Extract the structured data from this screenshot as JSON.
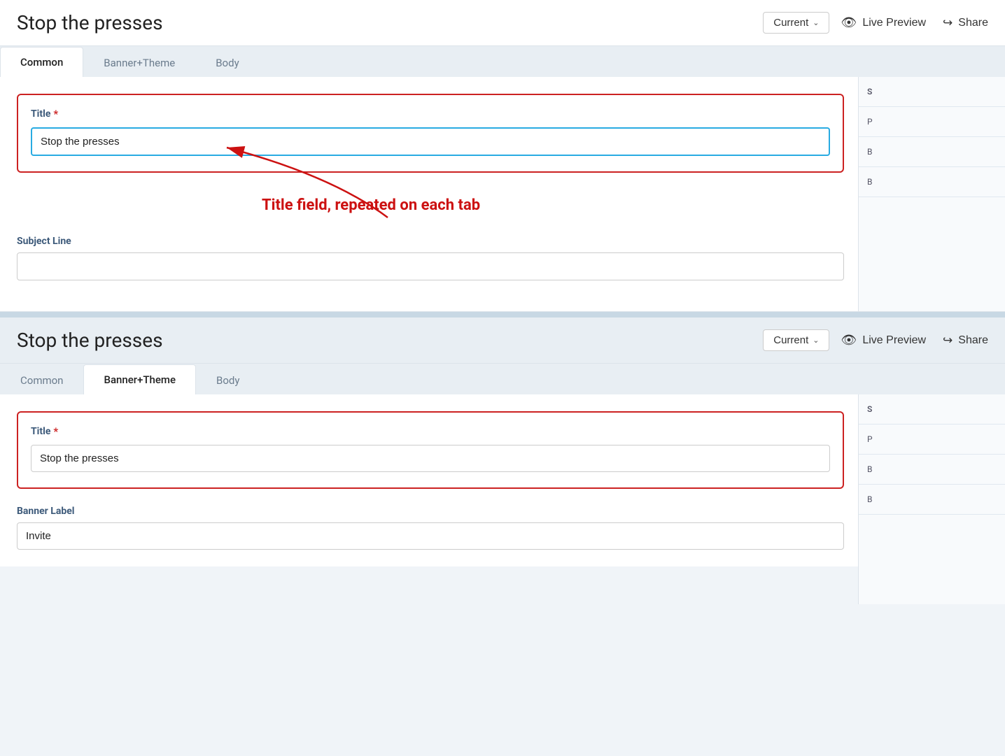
{
  "app": {
    "title": "Stop the presses"
  },
  "header1": {
    "title": "Stop the presses",
    "current_label": "Current",
    "live_preview_label": "Live Preview",
    "share_label": "Share"
  },
  "header2": {
    "title": "Stop the presses",
    "current_label": "Current",
    "live_preview_label": "Live Preview",
    "share_label": "Share"
  },
  "tabs1": {
    "items": [
      {
        "label": "Common",
        "active": true
      },
      {
        "label": "Banner+Theme",
        "active": false
      },
      {
        "label": "Body",
        "active": false
      }
    ]
  },
  "tabs2": {
    "items": [
      {
        "label": "Common",
        "active": false
      },
      {
        "label": "Banner+Theme",
        "active": true
      },
      {
        "label": "Body",
        "active": false
      }
    ]
  },
  "form1": {
    "title_label": "Title",
    "title_value": "Stop the presses",
    "title_placeholder": "",
    "subject_label": "Subject Line",
    "subject_value": "",
    "subject_placeholder": ""
  },
  "form2": {
    "title_label": "Title",
    "title_value": "Stop the presses",
    "title_placeholder": "",
    "banner_label": "Banner Label",
    "banner_value": "Invite",
    "banner_placeholder": ""
  },
  "annotation": {
    "text": "Title field, repeated on each tab"
  },
  "sidebar1": {
    "items": [
      "S",
      "P",
      "B",
      "B"
    ]
  },
  "sidebar2": {
    "items": [
      "S",
      "P",
      "B",
      "B"
    ]
  },
  "icons": {
    "eye": "👁",
    "share": "↪",
    "chevron": "∨"
  }
}
